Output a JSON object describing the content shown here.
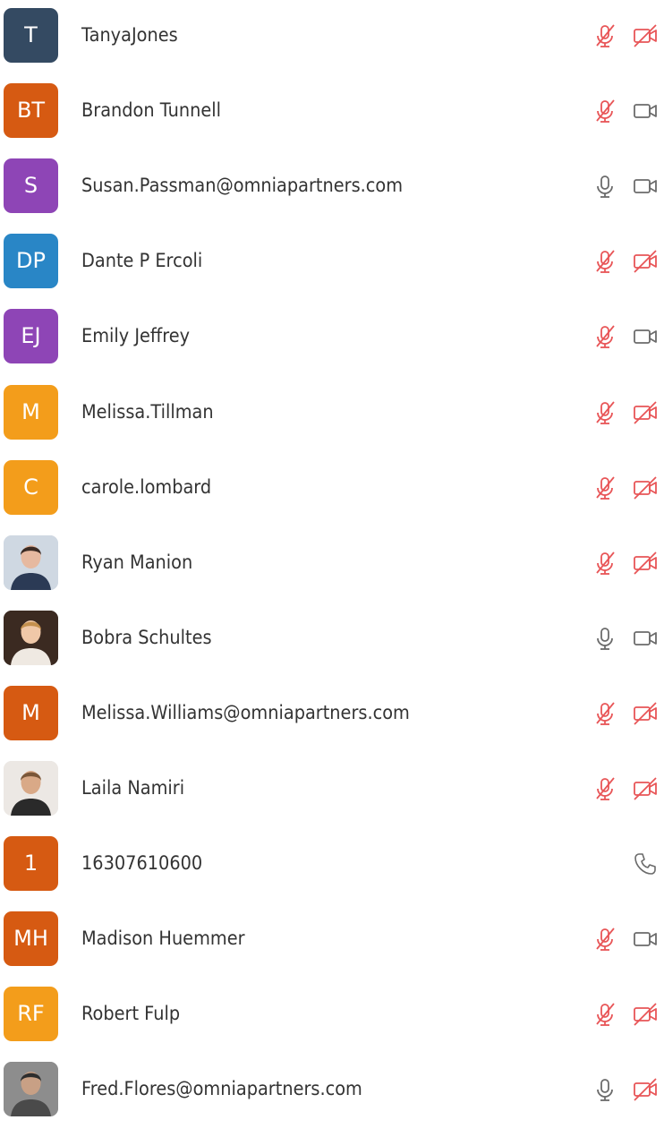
{
  "colors": {
    "muted_red": "#e85557",
    "icon_gray": "#6b6b6b",
    "text": "#333333"
  },
  "participants": [
    {
      "initials": "T",
      "name": "TanyaJones",
      "avatar_color": "#344a62",
      "avatar_type": "initials",
      "mic": "muted",
      "video": "off"
    },
    {
      "initials": "BT",
      "name": "Brandon Tunnell",
      "avatar_color": "#d65a12",
      "avatar_type": "initials",
      "mic": "muted",
      "video": "on"
    },
    {
      "initials": "S",
      "name": "Susan.Passman@omniapartners.com",
      "avatar_color": "#8e45b6",
      "avatar_type": "initials",
      "mic": "on",
      "video": "on"
    },
    {
      "initials": "DP",
      "name": "Dante P Ercoli",
      "avatar_color": "#2986c6",
      "avatar_type": "initials",
      "mic": "muted",
      "video": "off"
    },
    {
      "initials": "EJ",
      "name": "Emily Jeffrey",
      "avatar_color": "#8e45b6",
      "avatar_type": "initials",
      "mic": "muted",
      "video": "on"
    },
    {
      "initials": "M",
      "name": "Melissa.Tillman",
      "avatar_color": "#f39d1b",
      "avatar_type": "initials",
      "mic": "muted",
      "video": "off"
    },
    {
      "initials": "C",
      "name": "carole.lombard",
      "avatar_color": "#f39d1b",
      "avatar_type": "initials",
      "mic": "muted",
      "video": "off"
    },
    {
      "initials": "",
      "name": "Ryan Manion",
      "avatar_color": "#c9d4df",
      "avatar_type": "photo",
      "mic": "muted",
      "video": "off"
    },
    {
      "initials": "",
      "name": "Bobra Schultes",
      "avatar_color": "#3a2a22",
      "avatar_type": "photo",
      "mic": "on",
      "video": "on"
    },
    {
      "initials": "M",
      "name": "Melissa.Williams@omniapartners.com",
      "avatar_color": "#d65a12",
      "avatar_type": "initials",
      "mic": "muted",
      "video": "off"
    },
    {
      "initials": "",
      "name": "Laila Namiri",
      "avatar_color": "#ebe7e3",
      "avatar_type": "photo",
      "mic": "muted",
      "video": "off"
    },
    {
      "initials": "1",
      "name": "16307610600",
      "avatar_color": "#d65a12",
      "avatar_type": "initials",
      "mic": "phone",
      "video": "none"
    },
    {
      "initials": "MH",
      "name": "Madison Huemmer",
      "avatar_color": "#d65a12",
      "avatar_type": "initials",
      "mic": "muted",
      "video": "on"
    },
    {
      "initials": "RF",
      "name": "Robert Fulp",
      "avatar_color": "#f39d1b",
      "avatar_type": "initials",
      "mic": "muted",
      "video": "off"
    },
    {
      "initials": "",
      "name": "Fred.Flores@omniapartners.com",
      "avatar_color": "#9a9a9a",
      "avatar_type": "photo",
      "mic": "on",
      "video": "off"
    }
  ]
}
